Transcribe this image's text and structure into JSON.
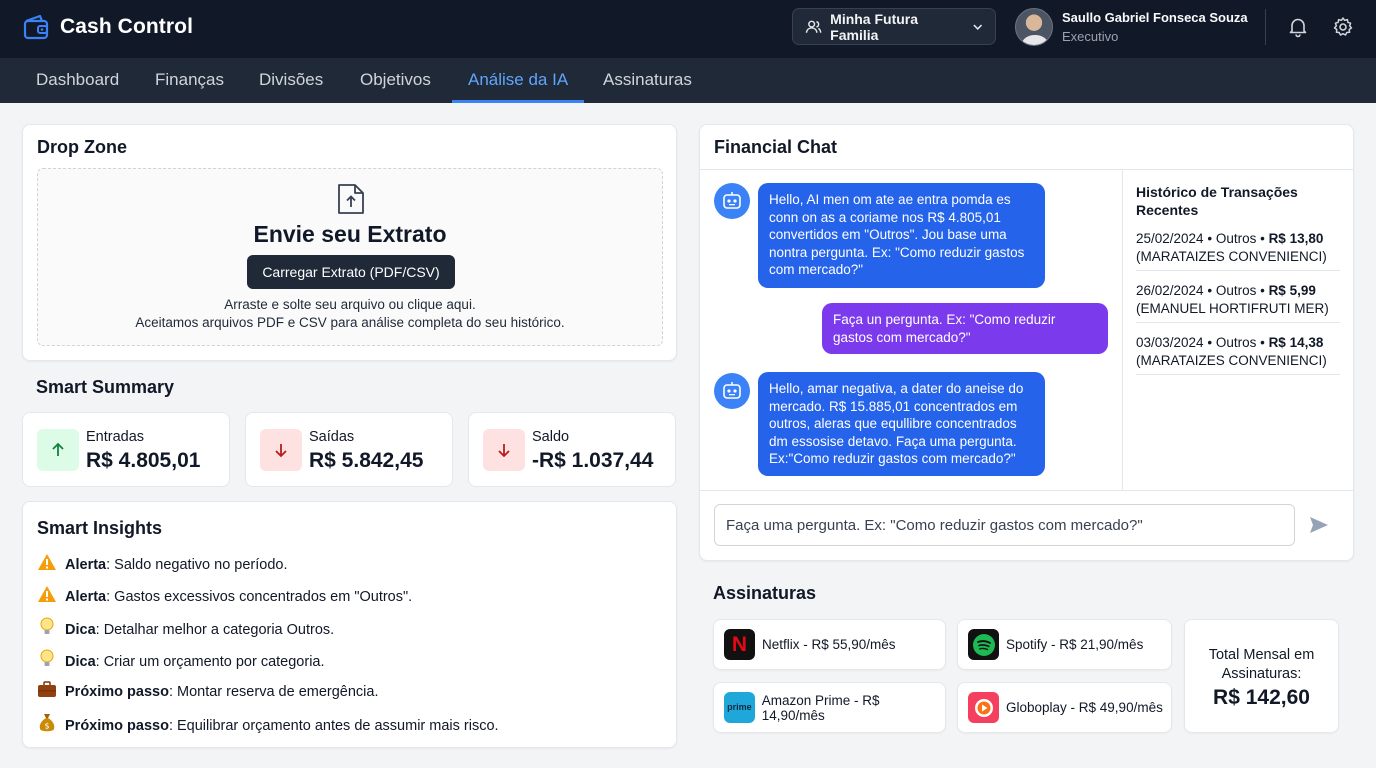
{
  "app": {
    "title": "Cash Control"
  },
  "header": {
    "family_selector": "Minha Futura Familia",
    "user": {
      "name": "Saullo Gabriel Fonseca Souza",
      "role": "Executivo"
    }
  },
  "nav": {
    "tabs": [
      {
        "label": "Dashboard"
      },
      {
        "label": "Finanças"
      },
      {
        "label": "Divisões"
      },
      {
        "label": "Objetivos"
      },
      {
        "label": "Análise da IA",
        "active": true
      },
      {
        "label": "Assinaturas"
      }
    ]
  },
  "dropzone": {
    "title": "Drop Zone",
    "heading": "Envie seu Extrato",
    "button": "Carregar Extrato (PDF/CSV)",
    "hint1": "Arraste e solte seu arquivo ou clique aqui.",
    "hint2": "Aceitamos arquivos PDF e CSV para análise completa do seu histórico."
  },
  "summary": {
    "title": "Smart Summary",
    "cards": [
      {
        "label": "Entradas",
        "value": "R$ 4.805,01"
      },
      {
        "label": "Saídas",
        "value": "R$ 5.842,45"
      },
      {
        "label": "Saldo",
        "value": "-R$ 1.037,44"
      }
    ]
  },
  "insights": {
    "title": "Smart Insights",
    "items": [
      {
        "label": "Alerta",
        "text": ": Saldo negativo no período.",
        "icon": "warning-icon"
      },
      {
        "label": "Alerta",
        "text": ": Gastos excessivos concentrados em \"Outros\".",
        "icon": "warning-icon"
      },
      {
        "label": "Dica",
        "text": ": Detalhar melhor a categoria Outros.",
        "icon": "lightbulb-icon"
      },
      {
        "label": "Dica",
        "text": ": Criar um orçamento por categoria.",
        "icon": "lightbulb-icon"
      },
      {
        "label": "Próximo passo",
        "text": ": Montar reserva de emergência.",
        "icon": "briefcase-icon"
      },
      {
        "label": "Próximo passo",
        "text": ": Equilibrar orçamento antes de assumir mais risco.",
        "icon": "money-bag-icon"
      }
    ]
  },
  "chat": {
    "title": "Financial Chat",
    "messages": [
      {
        "from": "bot",
        "text": "Hello, AI men om ate ae entra pomda es conn on as a coriame nos R$ 4.805,01 convertidos em \"Outros\". Jou base uma nontra pergunta. Ex: \"Como reduzir gastos com mercado?\""
      },
      {
        "from": "user",
        "text": "Faça un pergunta. Ex: \"Como reduzir gastos com mercado?\""
      },
      {
        "from": "bot",
        "text": "Hello, amar negativa, a dater do aneise do mercado. R$ 15.885,01 concentrados em outros, aleras que equllibre concentrados dm essosise detavo. Faça uma pergunta. Ex:\"Como reduzir gastos com mercado?\""
      }
    ],
    "input_placeholder": "Faça uma pergunta. Ex: \"Como reduzir gastos com mercado?\"",
    "history": {
      "title": "Histórico de Transações Recentes",
      "items": [
        {
          "date": "25/02/2024",
          "category": "Outros",
          "amount": "R$ 13,80",
          "merchant": "(MARATAIZES CONVENIENCI)"
        },
        {
          "date": "26/02/2024",
          "category": "Outros",
          "amount": "R$ 5,99",
          "merchant": "(EMANUEL HORTIFRUTI MER)"
        },
        {
          "date": "03/03/2024",
          "category": "Outros",
          "amount": "R$ 14,38",
          "merchant": "(MARATAIZES CONVENIENCI)"
        }
      ]
    }
  },
  "subscriptions": {
    "title": "Assinaturas",
    "items": [
      {
        "label": "Netflix - R$ 55,90/mês",
        "icon": "netflix-logo",
        "logo_text": "N",
        "color": "#e50914"
      },
      {
        "label": "Spotify - R$ 21,90/mês",
        "icon": "spotify-logo",
        "color": "#1db954"
      },
      {
        "label": "Amazon Prime - R$ 14,90/mês",
        "icon": "prime-logo",
        "logo_text": "prime",
        "color": "#1ea7d8"
      },
      {
        "label": "Globoplay - R$ 49,90/mês",
        "icon": "globoplay-logo",
        "color": "#f43f5e"
      }
    ],
    "total_label": "Total Mensal em Assinaturas:",
    "total_value": "R$ 142,60"
  }
}
